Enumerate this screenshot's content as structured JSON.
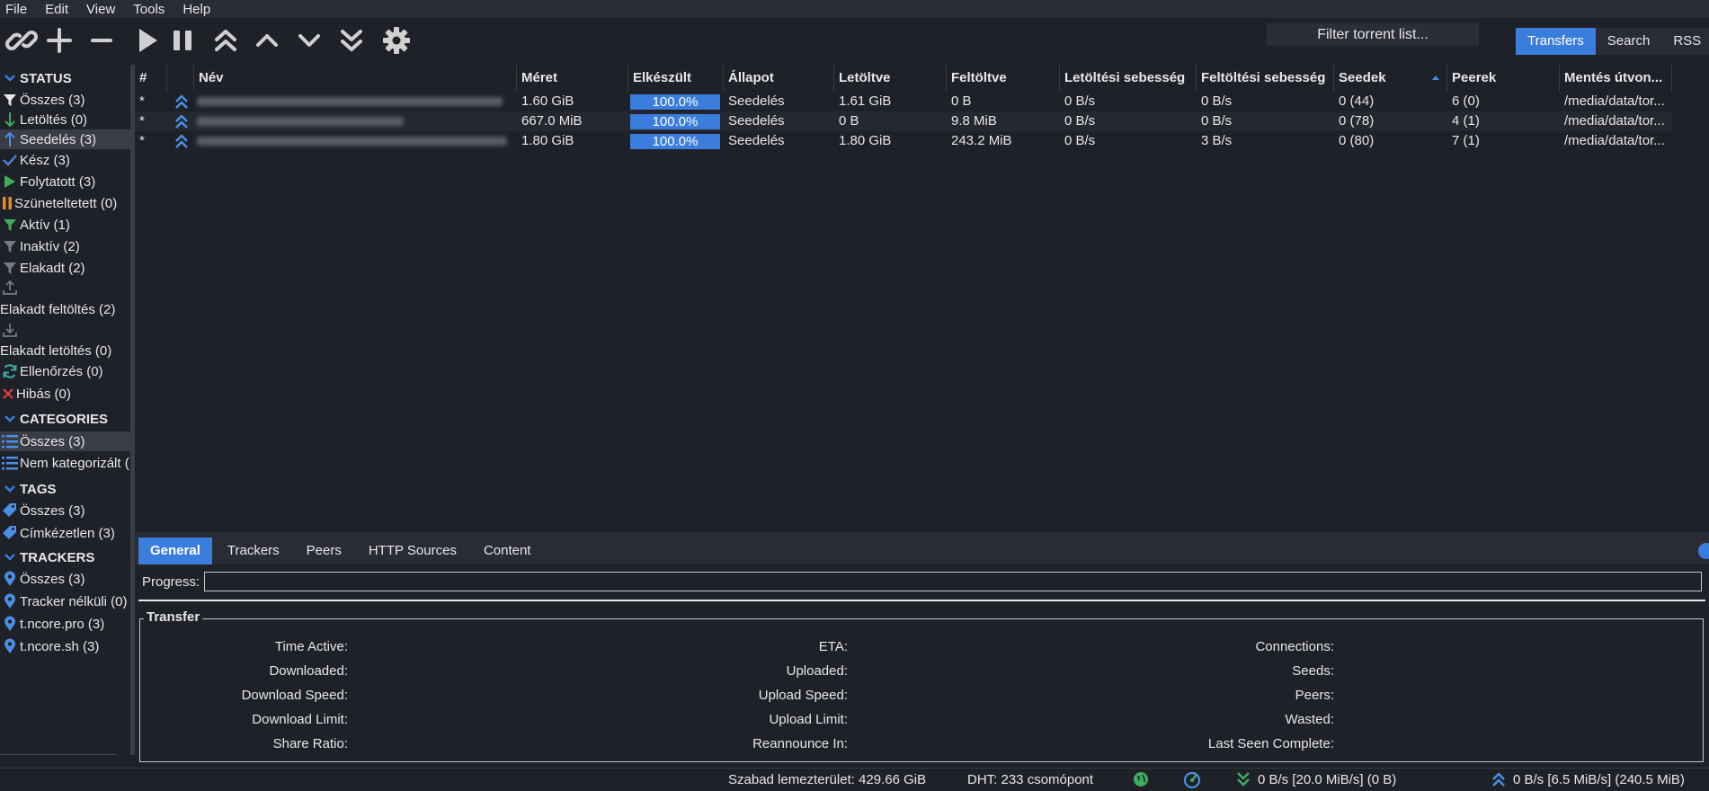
{
  "menu": [
    "File",
    "Edit",
    "View",
    "Tools",
    "Help"
  ],
  "toolbar": {
    "filter_placeholder": "Filter torrent list...",
    "view_tabs": [
      "Transfers",
      "Search",
      "RSS"
    ]
  },
  "sidebar": {
    "status_header": "STATUS",
    "status_items": [
      {
        "label": "Összes (3)",
        "icon": "filter-icon"
      },
      {
        "label": "Letöltés (0)",
        "icon": "arrow-down-icon"
      },
      {
        "label": "Seedelés (3)",
        "icon": "arrow-up-icon"
      },
      {
        "label": "Kész (3)",
        "icon": "check-icon"
      },
      {
        "label": "Folytatott (3)",
        "icon": "play-icon"
      },
      {
        "label": "Szüneteltetett (0)",
        "icon": "pause-icon"
      },
      {
        "label": "Aktív (1)",
        "icon": "filter-icon"
      },
      {
        "label": "Inaktív (2)",
        "icon": "filter-icon"
      },
      {
        "label": "Elakadt (2)",
        "icon": "filter-icon"
      },
      {
        "label": "Elakadt feltöltés (2)",
        "icon": "upload-tray-icon"
      },
      {
        "label": "Elakadt letöltés (0)",
        "icon": "download-tray-icon"
      },
      {
        "label": "Ellenőrzés (0)",
        "icon": "refresh-icon"
      },
      {
        "label": "Hibás (0)",
        "icon": "error-icon"
      }
    ],
    "categories_header": "CATEGORIES",
    "category_items": [
      {
        "label": "Összes (3)",
        "icon": "list-icon"
      },
      {
        "label": "Nem kategorizált (",
        "icon": "list-icon"
      }
    ],
    "tags_header": "TAGS",
    "tag_items": [
      {
        "label": "Összes (3)",
        "icon": "tag-icon"
      },
      {
        "label": "Címkézetlen (3)",
        "icon": "tag-icon"
      }
    ],
    "trackers_header": "TRACKERS",
    "tracker_items": [
      {
        "label": "Összes (3)",
        "icon": "pin-icon"
      },
      {
        "label": "Tracker nélküli (0)",
        "icon": "pin-icon"
      },
      {
        "label": "t.ncore.pro (3)",
        "icon": "pin-icon"
      },
      {
        "label": "t.ncore.sh (3)",
        "icon": "pin-icon"
      }
    ]
  },
  "table": {
    "columns": [
      "#",
      "",
      "Név",
      "Méret",
      "Elkészült",
      "Állapot",
      "Letöltve",
      "Feltöltve",
      "Letöltési sebesség",
      "Feltöltési sebesség",
      "Seedek",
      "Peerek",
      "Mentés útvon..."
    ],
    "rows": [
      {
        "num": "*",
        "size": "1.60 GiB",
        "done": "100.0%",
        "progress": 1.0,
        "state": "Seedelés",
        "downloaded": "1.61 GiB",
        "uploaded": "0 B",
        "dl_speed": "0 B/s",
        "ul_speed": "0 B/s",
        "seeds": "0 (44)",
        "peers": "6 (0)",
        "path": "/media/data/tor..."
      },
      {
        "num": "*",
        "size": "667.0 MiB",
        "done": "100.0%",
        "progress": 1.0,
        "state": "Seedelés",
        "downloaded": "0 B",
        "uploaded": "9.8 MiB",
        "dl_speed": "0 B/s",
        "ul_speed": "0 B/s",
        "seeds": "0 (78)",
        "peers": "4 (1)",
        "path": "/media/data/tor..."
      },
      {
        "num": "*",
        "size": "1.80 GiB",
        "done": "100.0%",
        "progress": 1.0,
        "state": "Seedelés",
        "downloaded": "1.80 GiB",
        "uploaded": "243.2 MiB",
        "dl_speed": "0 B/s",
        "ul_speed": "3 B/s",
        "seeds": "0 (80)",
        "peers": "7 (1)",
        "path": "/media/data/tor..."
      }
    ]
  },
  "details": {
    "tabs": [
      "General",
      "Trackers",
      "Peers",
      "HTTP Sources",
      "Content"
    ],
    "progress_label": "Progress:",
    "transfer_title": "Transfer",
    "col1": [
      "Time Active:",
      "Downloaded:",
      "Download Speed:",
      "Download Limit:",
      "Share Ratio:"
    ],
    "col2": [
      "ETA:",
      "Uploaded:",
      "Upload Speed:",
      "Upload Limit:",
      "Reannounce In:"
    ],
    "col3": [
      "Connections:",
      "Seeds:",
      "Peers:",
      "Wasted:",
      "Last Seen Complete:"
    ]
  },
  "statusbar": {
    "free_space": "Szabad lemezterület: 429.66 GiB",
    "dht": "DHT: 233 csomópont",
    "download": "0 B/s [20.0 MiB/s] (0 B)",
    "upload": "0 B/s [6.5 MiB/s] (240.5 MiB)"
  },
  "colors": {
    "accent": "#3b7ddd",
    "background": "#1f2129"
  }
}
